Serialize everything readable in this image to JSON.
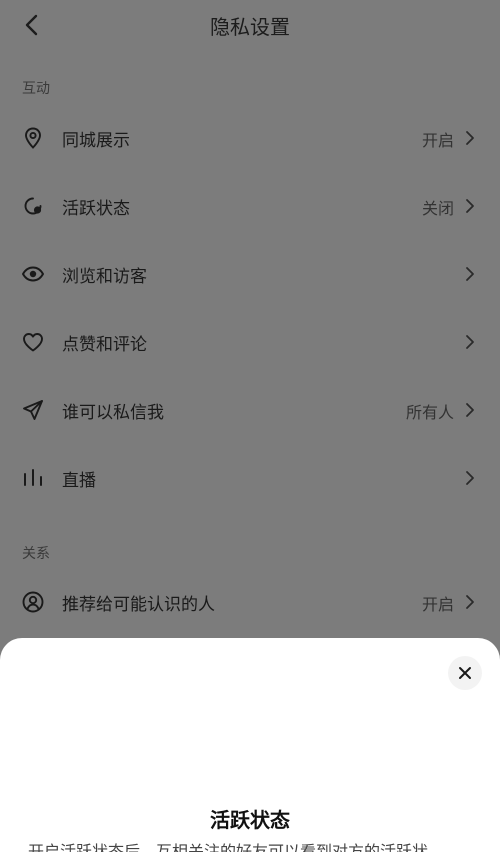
{
  "header": {
    "title": "隐私设置",
    "back_icon": "chevron-left-icon"
  },
  "sections": {
    "interaction": {
      "label": "互动",
      "items": [
        {
          "label": "同城展示",
          "value": "开启",
          "icon": "location-pin-icon"
        },
        {
          "label": "活跃状态",
          "value": "关闭",
          "icon": "active-status-icon"
        },
        {
          "label": "浏览和访客",
          "value": "",
          "icon": "eye-icon"
        },
        {
          "label": "点赞和评论",
          "value": "",
          "icon": "heart-icon"
        },
        {
          "label": "谁可以私信我",
          "value": "所有人",
          "icon": "send-icon"
        },
        {
          "label": "直播",
          "value": "",
          "icon": "bars-icon"
        }
      ]
    },
    "relations": {
      "label": "关系",
      "items": [
        {
          "label": "推荐给可能认识的人",
          "value": "开启",
          "icon": "person-circle-icon"
        }
      ]
    }
  },
  "sheet": {
    "title": "活跃状态",
    "description": "开启活跃状态后，互相关注的好友可以看到对方的活跃状",
    "close_icon": "close-icon"
  },
  "colors": {
    "overlay_background": "#7c7c7c",
    "sheet_background": "#ffffff"
  }
}
